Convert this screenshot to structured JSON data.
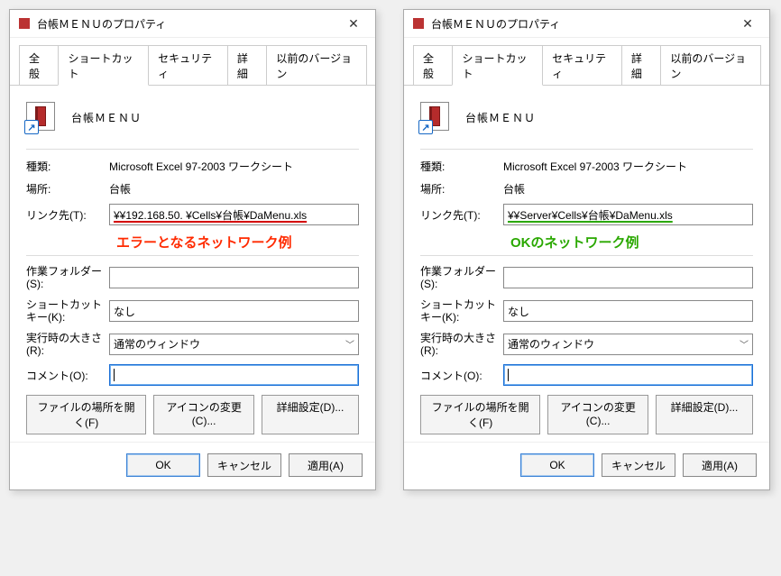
{
  "shared": {
    "window_title": "台帳ＭＥＮＵのプロパティ",
    "tabs": {
      "general": "全般",
      "shortcut": "ショートカット",
      "security": "セキュリティ",
      "detail": "詳細",
      "previous": "以前のバージョン"
    },
    "app_title": "台帳ＭＥＮＵ",
    "labels": {
      "type": "種類:",
      "location": "場所:",
      "target": "リンク先(T):",
      "startin": "作業フォルダー(S):",
      "shortcutkey": "ショートカット キー(K):",
      "run": "実行時の大きさ(R):",
      "comment": "コメント(O):"
    },
    "values": {
      "type": "Microsoft Excel 97-2003 ワークシート",
      "location": "台帳",
      "shortcutkey": "なし",
      "run": "通常のウィンドウ",
      "startin": "",
      "comment": ""
    },
    "buttons": {
      "open": "ファイルの場所を開く(F)",
      "change": "アイコンの変更(C)...",
      "adv": "詳細設定(D)...",
      "ok": "OK",
      "cancel": "キャンセル",
      "apply": "適用(A)"
    }
  },
  "left": {
    "target": "¥¥192.168.50.   ¥Cells¥台帳¥DaMenu.xls",
    "annotation": "エラーとなるネットワーク例"
  },
  "right": {
    "target": "¥¥Server¥Cells¥台帳¥DaMenu.xls",
    "annotation": "OKのネットワーク例"
  }
}
